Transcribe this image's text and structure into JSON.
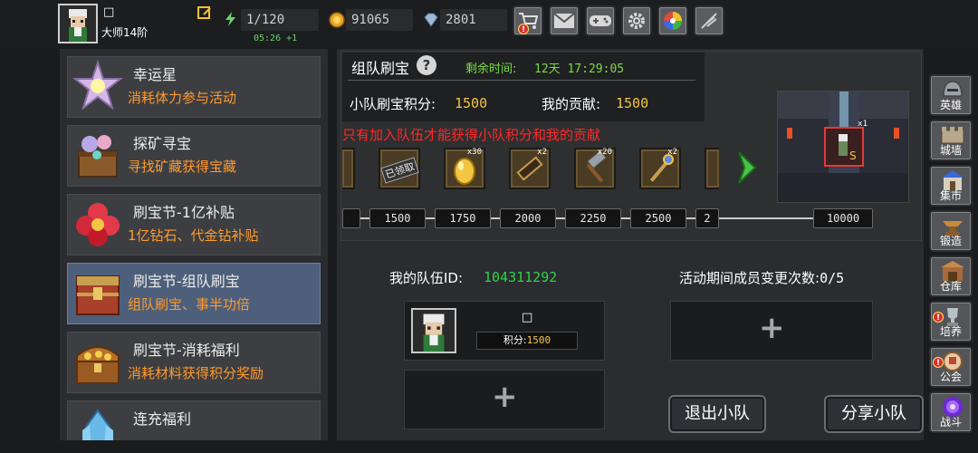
{
  "player": {
    "name": "□",
    "rank": "大师14阶"
  },
  "resources": {
    "energy": "1/120",
    "energy_timer": "05:26 +1",
    "gold": "91065",
    "gems": "2801"
  },
  "top_buttons": [
    "shop-cart-icon",
    "mail-icon",
    "gamepad-icon",
    "settings-gear-icon",
    "color-wheel-icon",
    "feather-icon"
  ],
  "activities": [
    {
      "title": "幸运星",
      "subtitle": "消耗体力参与活动",
      "icon": "lucky-star-icon"
    },
    {
      "title": "探矿寻宝",
      "subtitle": "寻找矿藏获得宝藏",
      "icon": "mining-chest-icon"
    },
    {
      "title": "刷宝节-1亿补贴",
      "subtitle": "1亿钻石、代金钻补贴",
      "icon": "red-flower-icon"
    },
    {
      "title": "刷宝节-组队刷宝",
      "subtitle": "组队刷宝、事半功倍",
      "icon": "team-chest-icon",
      "active": true
    },
    {
      "title": "刷宝节-消耗福利",
      "subtitle": "消耗材料获得积分奖励",
      "icon": "treasure-chest-icon"
    },
    {
      "title": "连充福利",
      "subtitle": "",
      "icon": "crystal-icon"
    }
  ],
  "event": {
    "title": "组队刷宝",
    "remaining_label": "剩余时间:",
    "remaining_value": "12天 17:29:05",
    "team_score_label": "小队刷宝积分:",
    "team_score_value": "1500",
    "my_contrib_label": "我的贡献:",
    "my_contrib_value": "1500",
    "warning": "只有加入队伍才能获得小队积分和我的贡献",
    "claimed_stamp": "已领取",
    "rewards": [
      {
        "name": "claimed-reward",
        "qty": ""
      },
      {
        "name": "golden-egg-icon",
        "qty": "x30"
      },
      {
        "name": "scroll-icon",
        "qty": "x2"
      },
      {
        "name": "hammer-icon",
        "qty": "x20"
      },
      {
        "name": "staff-icon",
        "qty": "x2"
      }
    ],
    "milestones": [
      "1500",
      "1750",
      "2000",
      "2250",
      "2500",
      "2"
    ],
    "milestone_final": "10000",
    "preview_qty": "x1"
  },
  "team": {
    "id_label": "我的队伍ID:",
    "id_value": "104311292",
    "changes_label": "活动期间成员变更次数:",
    "changes_value": "0/5",
    "member_name": "□",
    "member_score_label": "积分:",
    "member_score_value": "1500",
    "leave_button": "退出小队",
    "share_button": "分享小队"
  },
  "right_nav": [
    {
      "label": "英雄",
      "icon": "helmet-icon"
    },
    {
      "label": "城墙",
      "icon": "wall-icon"
    },
    {
      "label": "集市",
      "icon": "market-icon"
    },
    {
      "label": "锻造",
      "icon": "anvil-icon"
    },
    {
      "label": "仓库",
      "icon": "warehouse-icon"
    },
    {
      "label": "培养",
      "icon": "trophy-icon"
    },
    {
      "label": "公会",
      "icon": "guild-icon"
    },
    {
      "label": "战斗",
      "icon": "portal-icon"
    }
  ],
  "colors": {
    "accent_orange": "#ff9a2e",
    "gold_text": "#f4c542",
    "green_text": "#7cdb43",
    "warning_red": "#ff2828",
    "active_item": "#4d5f7a"
  }
}
